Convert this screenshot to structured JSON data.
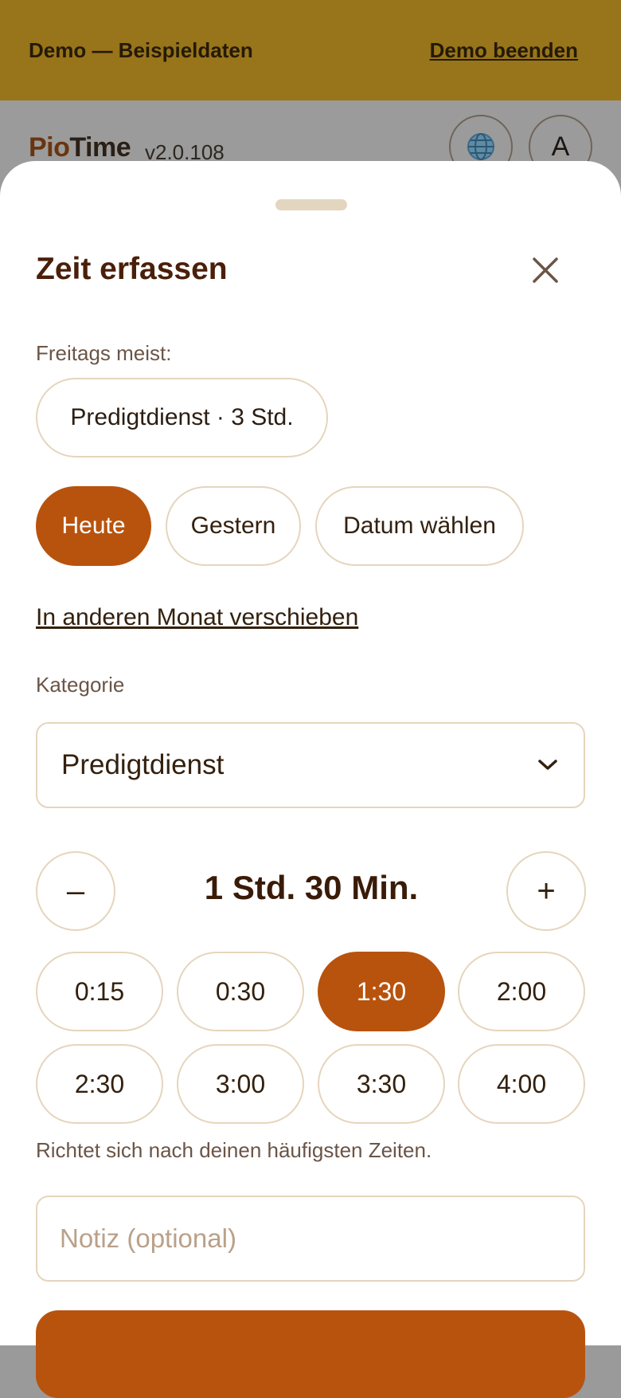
{
  "demo_bar": {
    "text": "Demo — Beispieldaten",
    "end_label": "Demo beenden"
  },
  "header": {
    "brand_part1": "Pio",
    "brand_part2": "Time",
    "version": "v2.0.108",
    "avatar_letter": "A",
    "language_icon": "globe-icon"
  },
  "sheet": {
    "title": "Zeit erfassen",
    "close_icon": "close-icon",
    "suggestion_label": "Freitags meist:",
    "suggestion_chip": "Predigtdienst · 3 Std.",
    "days": [
      {
        "label": "Heute",
        "active": true
      },
      {
        "label": "Gestern",
        "active": false
      },
      {
        "label": "Datum wählen",
        "active": false
      }
    ],
    "move_link": "In anderen Monat verschieben",
    "category_label": "Kategorie",
    "category_value": "Predigtdienst",
    "duration_value": "1 Std. 30 Min.",
    "minus_label": "–",
    "plus_label": "+",
    "durations": [
      {
        "label": "0:15",
        "active": false
      },
      {
        "label": "0:30",
        "active": false
      },
      {
        "label": "1:30",
        "active": true
      },
      {
        "label": "2:00",
        "active": false
      },
      {
        "label": "2:30",
        "active": false
      },
      {
        "label": "3:00",
        "active": false
      },
      {
        "label": "3:30",
        "active": false
      },
      {
        "label": "4:00",
        "active": false
      }
    ],
    "hint": "Richtet sich nach deinen häufigsten Zeiten.",
    "note_placeholder": "Notiz (optional)"
  },
  "colors": {
    "accent": "#b8530e",
    "demo_bar": "#98741a",
    "chip_border": "#e5d5bd",
    "title": "#4a1f0a"
  }
}
